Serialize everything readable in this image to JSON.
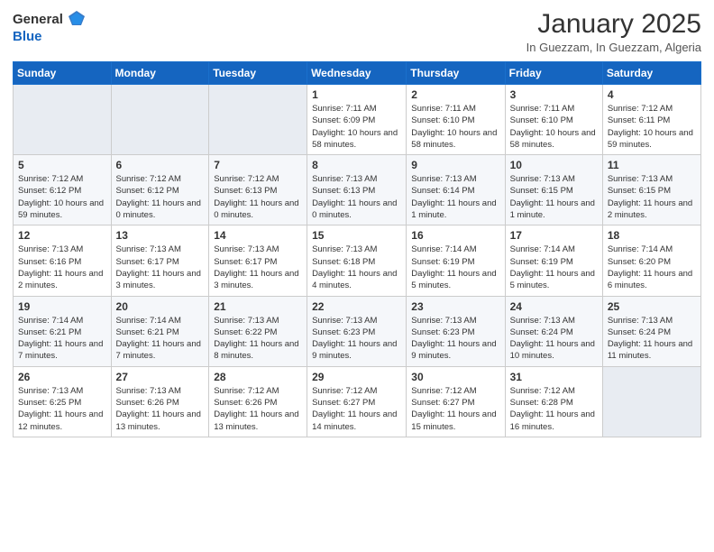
{
  "header": {
    "logo_general": "General",
    "logo_blue": "Blue",
    "title": "January 2025",
    "location": "In Guezzam, In Guezzam, Algeria"
  },
  "weekdays": [
    "Sunday",
    "Monday",
    "Tuesday",
    "Wednesday",
    "Thursday",
    "Friday",
    "Saturday"
  ],
  "weeks": [
    [
      {
        "day": "",
        "sunrise": "",
        "sunset": "",
        "daylight": ""
      },
      {
        "day": "",
        "sunrise": "",
        "sunset": "",
        "daylight": ""
      },
      {
        "day": "",
        "sunrise": "",
        "sunset": "",
        "daylight": ""
      },
      {
        "day": "1",
        "sunrise": "Sunrise: 7:11 AM",
        "sunset": "Sunset: 6:09 PM",
        "daylight": "Daylight: 10 hours and 58 minutes."
      },
      {
        "day": "2",
        "sunrise": "Sunrise: 7:11 AM",
        "sunset": "Sunset: 6:10 PM",
        "daylight": "Daylight: 10 hours and 58 minutes."
      },
      {
        "day": "3",
        "sunrise": "Sunrise: 7:11 AM",
        "sunset": "Sunset: 6:10 PM",
        "daylight": "Daylight: 10 hours and 58 minutes."
      },
      {
        "day": "4",
        "sunrise": "Sunrise: 7:12 AM",
        "sunset": "Sunset: 6:11 PM",
        "daylight": "Daylight: 10 hours and 59 minutes."
      }
    ],
    [
      {
        "day": "5",
        "sunrise": "Sunrise: 7:12 AM",
        "sunset": "Sunset: 6:12 PM",
        "daylight": "Daylight: 10 hours and 59 minutes."
      },
      {
        "day": "6",
        "sunrise": "Sunrise: 7:12 AM",
        "sunset": "Sunset: 6:12 PM",
        "daylight": "Daylight: 11 hours and 0 minutes."
      },
      {
        "day": "7",
        "sunrise": "Sunrise: 7:12 AM",
        "sunset": "Sunset: 6:13 PM",
        "daylight": "Daylight: 11 hours and 0 minutes."
      },
      {
        "day": "8",
        "sunrise": "Sunrise: 7:13 AM",
        "sunset": "Sunset: 6:13 PM",
        "daylight": "Daylight: 11 hours and 0 minutes."
      },
      {
        "day": "9",
        "sunrise": "Sunrise: 7:13 AM",
        "sunset": "Sunset: 6:14 PM",
        "daylight": "Daylight: 11 hours and 1 minute."
      },
      {
        "day": "10",
        "sunrise": "Sunrise: 7:13 AM",
        "sunset": "Sunset: 6:15 PM",
        "daylight": "Daylight: 11 hours and 1 minute."
      },
      {
        "day": "11",
        "sunrise": "Sunrise: 7:13 AM",
        "sunset": "Sunset: 6:15 PM",
        "daylight": "Daylight: 11 hours and 2 minutes."
      }
    ],
    [
      {
        "day": "12",
        "sunrise": "Sunrise: 7:13 AM",
        "sunset": "Sunset: 6:16 PM",
        "daylight": "Daylight: 11 hours and 2 minutes."
      },
      {
        "day": "13",
        "sunrise": "Sunrise: 7:13 AM",
        "sunset": "Sunset: 6:17 PM",
        "daylight": "Daylight: 11 hours and 3 minutes."
      },
      {
        "day": "14",
        "sunrise": "Sunrise: 7:13 AM",
        "sunset": "Sunset: 6:17 PM",
        "daylight": "Daylight: 11 hours and 3 minutes."
      },
      {
        "day": "15",
        "sunrise": "Sunrise: 7:13 AM",
        "sunset": "Sunset: 6:18 PM",
        "daylight": "Daylight: 11 hours and 4 minutes."
      },
      {
        "day": "16",
        "sunrise": "Sunrise: 7:14 AM",
        "sunset": "Sunset: 6:19 PM",
        "daylight": "Daylight: 11 hours and 5 minutes."
      },
      {
        "day": "17",
        "sunrise": "Sunrise: 7:14 AM",
        "sunset": "Sunset: 6:19 PM",
        "daylight": "Daylight: 11 hours and 5 minutes."
      },
      {
        "day": "18",
        "sunrise": "Sunrise: 7:14 AM",
        "sunset": "Sunset: 6:20 PM",
        "daylight": "Daylight: 11 hours and 6 minutes."
      }
    ],
    [
      {
        "day": "19",
        "sunrise": "Sunrise: 7:14 AM",
        "sunset": "Sunset: 6:21 PM",
        "daylight": "Daylight: 11 hours and 7 minutes."
      },
      {
        "day": "20",
        "sunrise": "Sunrise: 7:14 AM",
        "sunset": "Sunset: 6:21 PM",
        "daylight": "Daylight: 11 hours and 7 minutes."
      },
      {
        "day": "21",
        "sunrise": "Sunrise: 7:13 AM",
        "sunset": "Sunset: 6:22 PM",
        "daylight": "Daylight: 11 hours and 8 minutes."
      },
      {
        "day": "22",
        "sunrise": "Sunrise: 7:13 AM",
        "sunset": "Sunset: 6:23 PM",
        "daylight": "Daylight: 11 hours and 9 minutes."
      },
      {
        "day": "23",
        "sunrise": "Sunrise: 7:13 AM",
        "sunset": "Sunset: 6:23 PM",
        "daylight": "Daylight: 11 hours and 9 minutes."
      },
      {
        "day": "24",
        "sunrise": "Sunrise: 7:13 AM",
        "sunset": "Sunset: 6:24 PM",
        "daylight": "Daylight: 11 hours and 10 minutes."
      },
      {
        "day": "25",
        "sunrise": "Sunrise: 7:13 AM",
        "sunset": "Sunset: 6:24 PM",
        "daylight": "Daylight: 11 hours and 11 minutes."
      }
    ],
    [
      {
        "day": "26",
        "sunrise": "Sunrise: 7:13 AM",
        "sunset": "Sunset: 6:25 PM",
        "daylight": "Daylight: 11 hours and 12 minutes."
      },
      {
        "day": "27",
        "sunrise": "Sunrise: 7:13 AM",
        "sunset": "Sunset: 6:26 PM",
        "daylight": "Daylight: 11 hours and 13 minutes."
      },
      {
        "day": "28",
        "sunrise": "Sunrise: 7:12 AM",
        "sunset": "Sunset: 6:26 PM",
        "daylight": "Daylight: 11 hours and 13 minutes."
      },
      {
        "day": "29",
        "sunrise": "Sunrise: 7:12 AM",
        "sunset": "Sunset: 6:27 PM",
        "daylight": "Daylight: 11 hours and 14 minutes."
      },
      {
        "day": "30",
        "sunrise": "Sunrise: 7:12 AM",
        "sunset": "Sunset: 6:27 PM",
        "daylight": "Daylight: 11 hours and 15 minutes."
      },
      {
        "day": "31",
        "sunrise": "Sunrise: 7:12 AM",
        "sunset": "Sunset: 6:28 PM",
        "daylight": "Daylight: 11 hours and 16 minutes."
      },
      {
        "day": "",
        "sunrise": "",
        "sunset": "",
        "daylight": ""
      }
    ]
  ]
}
